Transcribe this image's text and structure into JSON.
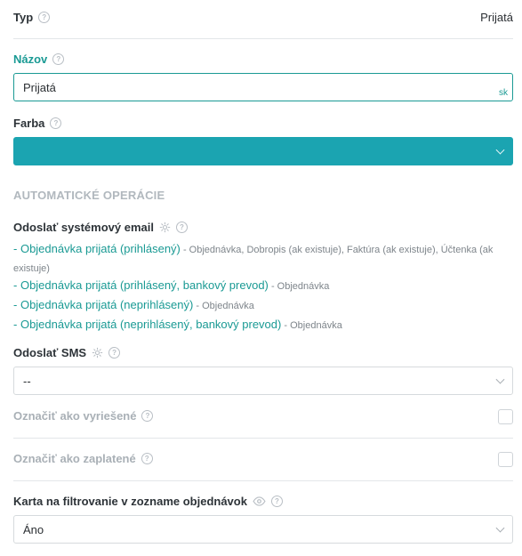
{
  "typ": {
    "label": "Typ",
    "value": "Prijatá"
  },
  "nazov": {
    "label": "Názov",
    "value": "Prijatá",
    "lang": "sk"
  },
  "farba": {
    "label": "Farba",
    "color": "#1ba4b1"
  },
  "auto_ops": {
    "title": "AUTOMATICKÉ OPERÁCIE"
  },
  "email": {
    "label": "Odoslať systémový email",
    "items": [
      {
        "prefix": "- ",
        "link": "Objednávka prijatá (prihlásený)",
        "desc": " - Objednávka, Dobropis (ak existuje), Faktúra (ak existuje), Účtenka (ak existuje)"
      },
      {
        "prefix": "- ",
        "link": "Objednávka prijatá (prihlásený, bankový prevod)",
        "desc": " - Objednávka"
      },
      {
        "prefix": "- ",
        "link": "Objednávka prijatá (neprihlásený)",
        "desc": " - Objednávka"
      },
      {
        "prefix": "- ",
        "link": "Objednávka prijatá (neprihlásený, bankový prevod)",
        "desc": " - Objednávka"
      }
    ]
  },
  "sms": {
    "label": "Odoslať SMS",
    "value": "--"
  },
  "vyriesene": {
    "label": "Označiť ako vyriešené"
  },
  "zaplatene": {
    "label": "Označiť ako zaplatené"
  },
  "karta": {
    "label": "Karta na filtrovanie v zozname objednávok",
    "value": "Áno"
  },
  "colors": {
    "accent": "#1a9a94",
    "swatch": "#1ba4b1"
  }
}
